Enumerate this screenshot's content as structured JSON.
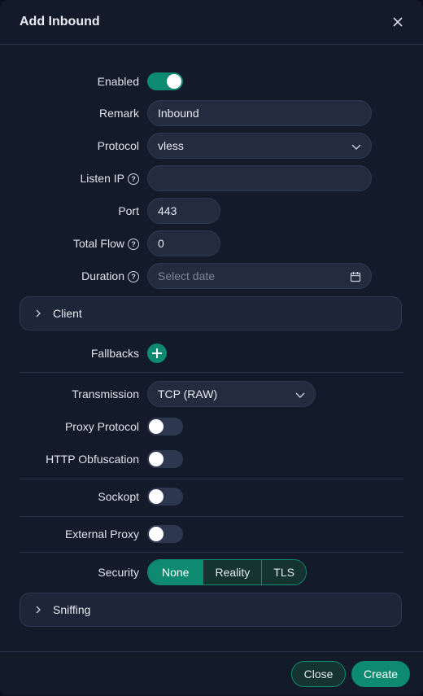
{
  "modal": {
    "title": "Add Inbound"
  },
  "form": {
    "enabled": {
      "label": "Enabled",
      "on": true
    },
    "remark": {
      "label": "Remark",
      "value": "Inbound"
    },
    "protocol": {
      "label": "Protocol",
      "value": "vless"
    },
    "listen_ip": {
      "label": "Listen IP",
      "value": ""
    },
    "port": {
      "label": "Port",
      "value": "443"
    },
    "total_flow": {
      "label": "Total Flow",
      "value": "0"
    },
    "duration": {
      "label": "Duration",
      "placeholder": "Select date"
    },
    "client": {
      "label": "Client"
    },
    "fallbacks": {
      "label": "Fallbacks"
    },
    "transmission": {
      "label": "Transmission",
      "value": "TCP (RAW)"
    },
    "proxy_protocol": {
      "label": "Proxy Protocol",
      "on": false
    },
    "http_obfuscation": {
      "label": "HTTP Obfuscation",
      "on": false
    },
    "sockopt": {
      "label": "Sockopt",
      "on": false
    },
    "external_proxy": {
      "label": "External Proxy",
      "on": false
    },
    "security": {
      "label": "Security",
      "options": [
        "None",
        "Reality",
        "TLS"
      ],
      "selected": "None"
    },
    "sniffing": {
      "label": "Sniffing"
    }
  },
  "footer": {
    "close_label": "Close",
    "create_label": "Create"
  },
  "colors": {
    "accent": "#0d8a70",
    "background": "#131a2a",
    "field": "#232c3e"
  },
  "icons": {
    "help": "?",
    "close": "close-icon",
    "chevron": "chevron-down-icon",
    "calendar": "calendar-icon",
    "plus": "plus-icon",
    "expand": "chevron-right-icon"
  }
}
